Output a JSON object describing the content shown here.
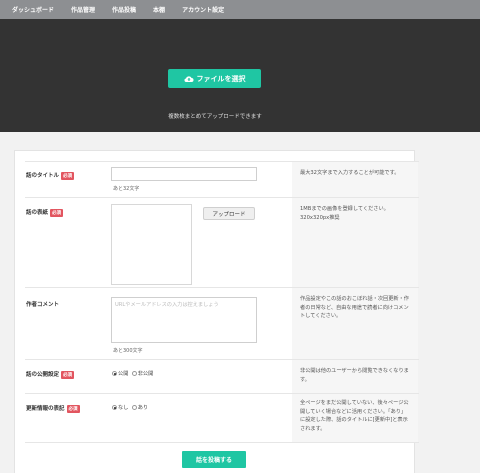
{
  "nav": [
    "ダッシュボード",
    "作品管理",
    "作品投稿",
    "本棚",
    "アカウント設定"
  ],
  "hero": {
    "button_label": "ファイルを選択",
    "note": "複数枚まとめてアップロードできます"
  },
  "form": {
    "required_badge": "必須",
    "title": {
      "label": "話のタイトル",
      "counter": "あと32文字",
      "help": "最大32文字まで入力することが可能です。"
    },
    "cover": {
      "label": "話の表紙",
      "upload_label": "アップロード",
      "help": "1MBまでの画像を登録してください。320x320px推奨"
    },
    "comment": {
      "label": "作者コメント",
      "placeholder": "URLやメールアドレスの入力は控えましょう",
      "counter": "あと300文字",
      "help": "作品設定やこの話のおこぼれ話・次回更新・作者の日常など、自由な用途で読者に向けコメントしてください。"
    },
    "visibility": {
      "label": "話の公開設定",
      "options": [
        "公開",
        "非公開"
      ],
      "selected": "公開",
      "help": "非公開は他のユーザーから閲覧できなくなります。"
    },
    "update_notice": {
      "label": "更新情報の表記",
      "options": [
        "なし",
        "あり"
      ],
      "selected": "なし",
      "help": "全ページをまだ公開していない、後々ページ公開していく場合などに活用ください。「あり」に設定した際、話のタイトルに[更新中]と表示されます。"
    },
    "submit_label": "話を投稿する"
  },
  "colors": {
    "accent": "#1fc6a3",
    "required": "#e2555f",
    "nav_bg": "#8d8f92",
    "hero_bg": "#333333"
  }
}
